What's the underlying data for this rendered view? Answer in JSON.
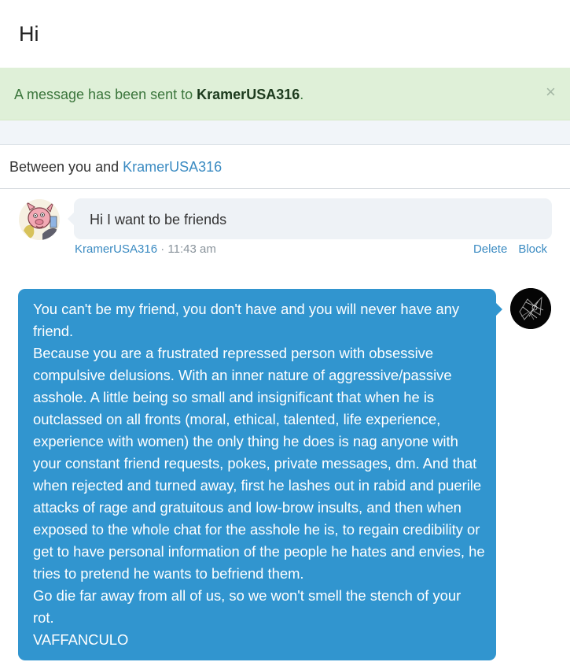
{
  "page": {
    "title": "Hi"
  },
  "alert": {
    "prefix": "A message has been sent to ",
    "recipient": "KramerUSA316",
    "suffix": ".",
    "close_glyph": "×"
  },
  "conversation": {
    "header_prefix": "Between you and ",
    "header_user": "KramerUSA316"
  },
  "messages": [
    {
      "author": "KramerUSA316",
      "separator": " · ",
      "time": "11:43 am",
      "text": "Hi I want to be friends",
      "actions": [
        "Delete",
        "Block"
      ]
    },
    {
      "paragraphs": [
        "You can't be my friend, you don't have and you will never have any friend.",
        "Because you are a frustrated repressed person with obsessive compulsive delusions. With an inner nature of aggressive/passive asshole. A little being so small and insignificant that when he is outclassed on all fronts (moral, ethical, talented, life experience, experience with women) the only thing he does is nag anyone with your constant friend requests, pokes, private messages, dm. And that when rejected and turned away, first he lashes out in rabid and puerile attacks of rage and gratuitous and low-brow insults, and then when exposed to the whole chat for the asshole he is, to regain credibility or get to have personal information of the people he hates and envies, he tries to pretend he wants to befriend them.",
        "Go die far away from all of us, so we won't smell the stench of your rot.",
        "VAFFANCULO"
      ]
    }
  ],
  "colors": {
    "accent": "#3b8bc2",
    "alert_bg": "#dff0d8",
    "outgoing_bubble": "#3195cf",
    "incoming_bubble": "#eef2f6"
  }
}
